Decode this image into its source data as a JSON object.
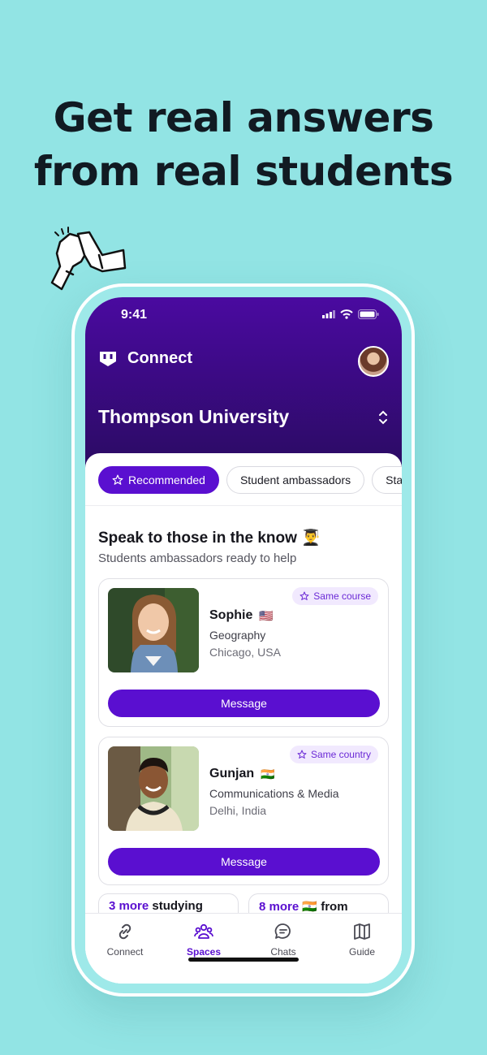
{
  "headline": {
    "line1": "Get real answers",
    "line2": "from real students"
  },
  "status_bar": {
    "time": "9:41"
  },
  "app": {
    "title": "Connect",
    "university": "Thompson University"
  },
  "tabs": [
    {
      "label": "Recommended",
      "active": true,
      "icon": "star-icon"
    },
    {
      "label": "Student ambassadors",
      "active": false
    },
    {
      "label": "Stat",
      "active": false
    }
  ],
  "section": {
    "title": "Speak to those in the know 👨‍🎓",
    "subtitle": "Students ambassadors ready to help"
  },
  "ambassadors": [
    {
      "name": "Sophie",
      "flag": "🇺🇸",
      "subject": "Geography",
      "location": "Chicago, USA",
      "badge": "Same course",
      "button": "Message"
    },
    {
      "name": "Gunjan",
      "flag": "🇮🇳",
      "subject": "Communications & Media",
      "location": "Delhi, India",
      "badge": "Same country",
      "button": "Message"
    }
  ],
  "more_cards": [
    {
      "highlight": "3 more",
      "rest": " studying"
    },
    {
      "highlight": "8 more",
      "rest": " 🇮🇳 from"
    }
  ],
  "bottom_nav": [
    {
      "label": "Connect",
      "icon": "link-icon",
      "active": false
    },
    {
      "label": "Spaces",
      "icon": "people-icon",
      "active": true
    },
    {
      "label": "Chats",
      "icon": "chat-bubble-icon",
      "active": false
    },
    {
      "label": "Guide",
      "icon": "map-icon",
      "active": false
    }
  ],
  "colors": {
    "background": "#92e4e4",
    "brand_purple": "#5a0fd0",
    "header_dark": "#2a0b62"
  }
}
